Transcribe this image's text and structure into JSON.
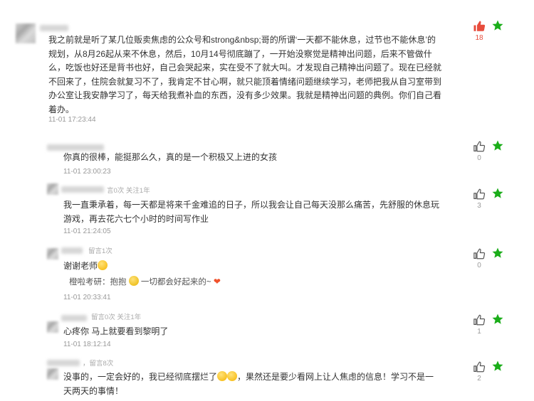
{
  "comments": [
    {
      "text_lines": [
        "我之前就是听了某几位贩卖焦虑的公众号和strong&nbsp;哥的所谓‘一天都不能休息，过节也不能休息’的",
        "规划，从8月26起从来不休息，然后，10月14号彻底蹦了，一开始没察觉是精神出问题，后来不管做什",
        "么，吃饭也好还是背书也好，自己会哭起来，实在受不了就大叫。才发现自己精神出问题了。现在已经就",
        "不回来了，住院会就复习不了，我肯定不甘心啊，就只能顶着情绪问题继续学习，老师把我从自习室带到",
        "办公室让我安静学习了，每天给我煮补血的东西，没有多少效果。我就是精神出问题的典例。你们自己看",
        "着办。"
      ],
      "time": "11-01 17:23:44",
      "likes": "18"
    },
    {
      "text": "你真的很棒，能挺那么久，真的是一个积极又上进的女孩",
      "time": "11-01 23:00:23",
      "likes": "0"
    },
    {
      "meta": "言0次 关注1年",
      "text_lines": [
        "我一直秉承着，每一天都是将来千金难追的日子，所以我会让自己每天没那么痛苦，先舒服的休息玩",
        "游戏，再去花六七个小时的时间写作业"
      ],
      "time": "11-01 21:24:05",
      "likes": "3"
    },
    {
      "meta": "留言1次",
      "text": "谢谢老师",
      "reply_prefix": "橙啦考研：抱抱",
      "reply_suffix": "一切都会好起来的~",
      "time": "11-01 20:33:41",
      "likes": "0"
    },
    {
      "meta": "留言0次 关注1年",
      "text": "心疼你 马上就要看到黎明了",
      "time": "11-01 18:12:14",
      "likes": "1"
    },
    {
      "meta": "，留言8次",
      "text_line1_a": "没事的，一定会好的，我已经彻底摆烂了",
      "text_line1_b": "，果然还是要少看网上让人焦虑的信息！学习不是一",
      "text_line2": "天两天的事情！",
      "likes": "2"
    }
  ],
  "colors": {
    "liked": "#e74c3c",
    "star": "#1aad19",
    "muted": "#999999"
  }
}
